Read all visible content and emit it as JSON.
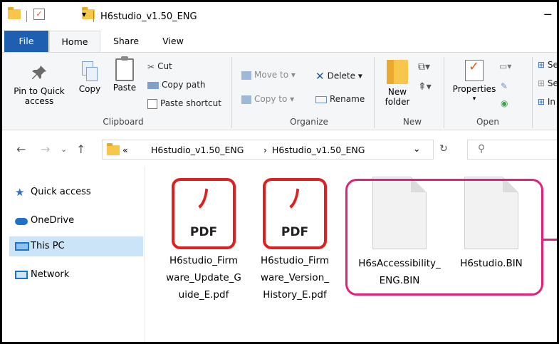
{
  "window": {
    "title": "H6studio_v1.50_ENG",
    "minimize_symbol": "─"
  },
  "tabs": [
    "File",
    "Home",
    "Share",
    "View"
  ],
  "ribbon": {
    "clipboard": {
      "pin_label": "Pin to Quick access",
      "copy_label": "Copy",
      "paste_label": "Paste",
      "cut_label": "Cut",
      "copy_path_label": "Copy path",
      "paste_shortcut_label": "Paste shortcut",
      "group_label": "Clipboard"
    },
    "organize": {
      "move_to_label": "Move to",
      "copy_to_label": "Copy to",
      "delete_label": "Delete",
      "rename_label": "Rename",
      "group_label": "Organize"
    },
    "new": {
      "new_folder_label": "New folder",
      "group_label": "New"
    },
    "open": {
      "properties_label": "Properties",
      "group_label": "Open"
    },
    "select": {
      "items": [
        "Se",
        "Se",
        "In"
      ]
    }
  },
  "address_bar": {
    "overflow": "«",
    "crumbs": [
      "H6studio_v1.50_ENG",
      "H6studio_v1.50_ENG"
    ],
    "separator": "›",
    "dropdown_symbol": "⌄",
    "refresh_symbol": "↻",
    "search_symbol": "⚲"
  },
  "nav_pane": {
    "items": [
      {
        "label": "Quick access",
        "icon": "star-icon"
      },
      {
        "label": "OneDrive",
        "icon": "cloud-icon"
      },
      {
        "label": "This PC",
        "icon": "monitor-icon",
        "selected": true
      },
      {
        "label": "Network",
        "icon": "network-icon"
      }
    ]
  },
  "files": [
    {
      "name_lines": [
        "H6studio_Firm",
        "ware_Update_G",
        "uide_E.pdf"
      ],
      "type": "pdf",
      "icon_text": "PDF"
    },
    {
      "name_lines": [
        "H6studio_Firm",
        "ware_Version_",
        "History_E.pdf"
      ],
      "type": "pdf",
      "icon_text": "PDF"
    },
    {
      "name_lines": [
        "H6sAccessibility_",
        "ENG.BIN"
      ],
      "type": "bin"
    },
    {
      "name_lines": [
        "H6studio.BIN"
      ],
      "type": "bin"
    }
  ],
  "colors": {
    "file_tab": "#1f5fb1",
    "selection": "#cce4f7",
    "highlight": "#e2227a",
    "pdf_red": "#e02020",
    "folder": "#f8c64a"
  }
}
